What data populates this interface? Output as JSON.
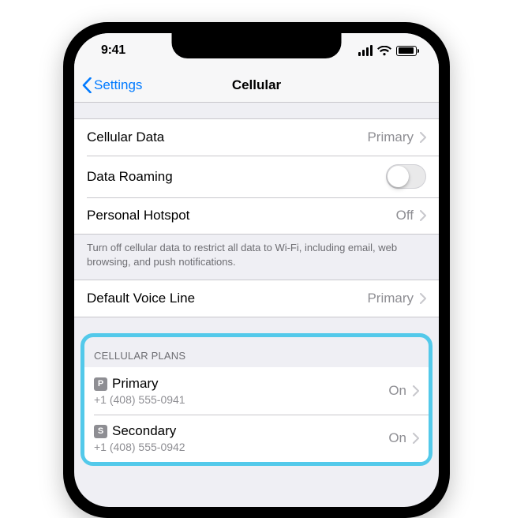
{
  "status": {
    "time": "9:41"
  },
  "nav": {
    "back": "Settings",
    "title": "Cellular"
  },
  "rows": {
    "cellularData": {
      "label": "Cellular Data",
      "value": "Primary"
    },
    "dataRoaming": {
      "label": "Data Roaming"
    },
    "personalHotspot": {
      "label": "Personal Hotspot",
      "value": "Off"
    },
    "footer": "Turn off cellular data to restrict all data to Wi-Fi, including email, web browsing, and push notifications.",
    "defaultVoice": {
      "label": "Default Voice Line",
      "value": "Primary"
    }
  },
  "plans": {
    "header": "CELLULAR PLANS",
    "items": [
      {
        "badge": "P",
        "name": "Primary",
        "number": "+1 (408) 555-0941",
        "status": "On"
      },
      {
        "badge": "S",
        "name": "Secondary",
        "number": "+1 (408) 555-0942",
        "status": "On"
      }
    ]
  }
}
